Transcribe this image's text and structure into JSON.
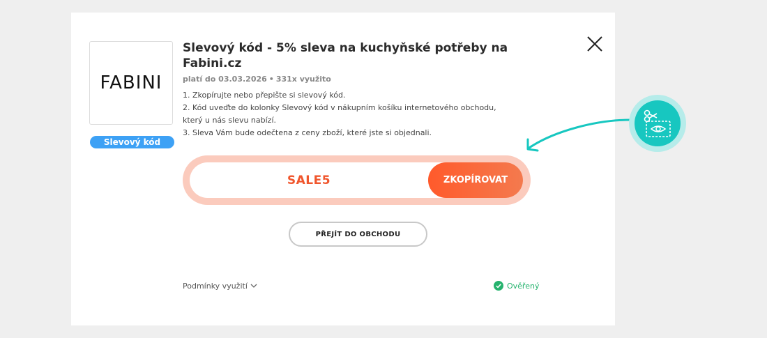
{
  "coupon": {
    "store_logo": "FABINI",
    "type_badge": "Slevový kód",
    "title": "Slevový kód - 5% sleva na kuchyňské potřeby na Fabini.cz",
    "valid_until": "platí do 03.03.2026",
    "separator": "•",
    "used_count": "331x využito",
    "steps": [
      "1. Zkopírujte nebo přepište si slevový kód.",
      "2. Kód uveďte do kolonky Slevový kód v nákupním košíku internetového obchodu, který u nás slevu nabízí.",
      "3. Sleva Vám bude odečtena z ceny zboží, které jste si objednali."
    ],
    "code": "SALE5",
    "copy_label": "ZKOPÍROVAT",
    "shop_label": "PŘEJÍT DO OBCHODU",
    "conditions_label": "Podmínky využití",
    "verified_label": "Ověřený"
  },
  "icons": {
    "close": "close-icon",
    "chevron": "chevron-down-icon",
    "verified": "check-circle-icon",
    "scissors": "scissors-coupon-icon",
    "arrow": "curved-arrow-icon"
  },
  "colors": {
    "accent": "#f0562d",
    "badge_blue": "#3da1f5",
    "verified_green": "#26b36e",
    "teal": "#17c7c0"
  }
}
